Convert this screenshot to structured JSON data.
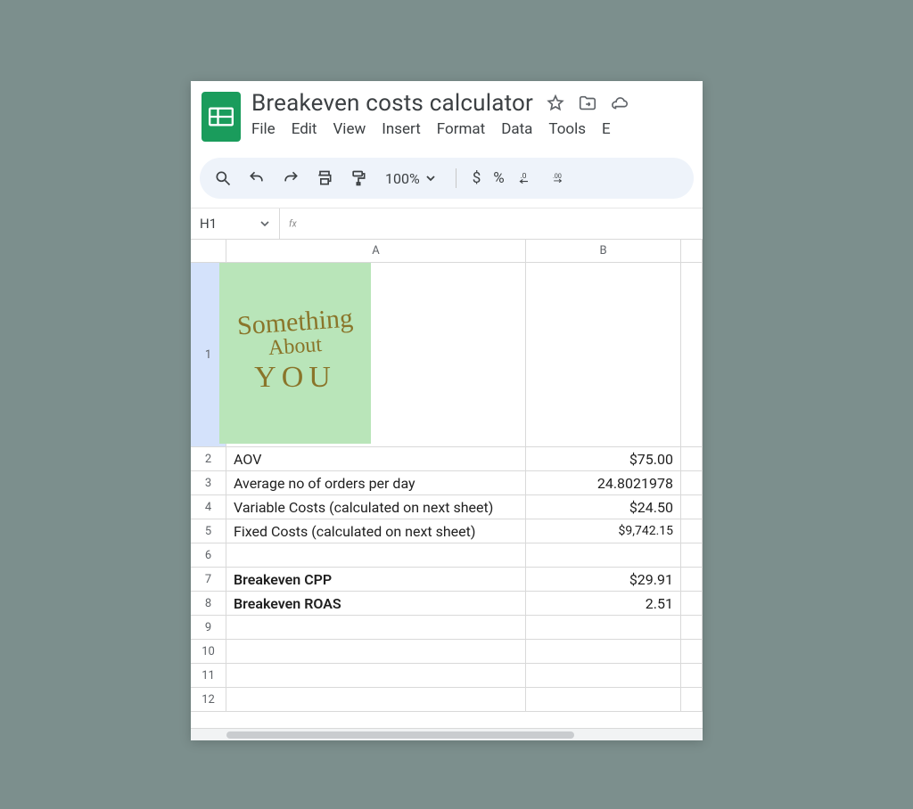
{
  "doc": {
    "title": "Breakeven costs calculator",
    "menus": {
      "file": "File",
      "edit": "Edit",
      "view": "View",
      "insert": "Insert",
      "format": "Format",
      "data": "Data",
      "tools": "Tools",
      "extensions_cut": "E"
    }
  },
  "toolbar": {
    "zoom": "100%",
    "currency": "$",
    "percent": "%",
    "dec_dec_icon": ".0",
    "inc_dec_icon": ".00"
  },
  "namebox": {
    "ref": "H1"
  },
  "columns": {
    "A": "A",
    "B": "B"
  },
  "logo": {
    "line1": "Something",
    "line2": "About",
    "line3": "YOU"
  },
  "cells": {
    "A2": "AOV",
    "B2": "$75.00",
    "A3": "Average no of orders per day",
    "B3": "24.8021978",
    "A4": "Variable Costs (calculated on next sheet)",
    "B4": "$24.50",
    "A5": "Fixed Costs (calculated on next sheet)",
    "B5": "$9,742.15",
    "A7": "Breakeven CPP",
    "B7": "$29.91",
    "A8": "Breakeven ROAS",
    "B8": "2.51"
  },
  "row_numbers": [
    "1",
    "2",
    "3",
    "4",
    "5",
    "6",
    "7",
    "8",
    "9",
    "10",
    "11",
    "12"
  ]
}
